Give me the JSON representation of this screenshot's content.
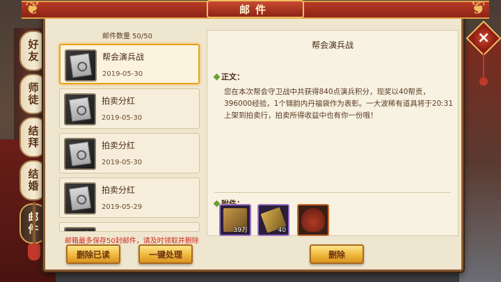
{
  "window": {
    "title": "邮件"
  },
  "close": {
    "icon": "×"
  },
  "side_tabs": [
    {
      "label": "好友",
      "active": false
    },
    {
      "label": "师徒",
      "active": false
    },
    {
      "label": "结拜",
      "active": false
    },
    {
      "label": "结婚",
      "active": false
    },
    {
      "label": "邮件",
      "active": true
    }
  ],
  "mail_list": {
    "count_label": "邮件数量 50/50",
    "items": [
      {
        "title": "帮会演兵战",
        "date": "2019-05-30",
        "icon": "mail-scroll-icon",
        "selected": true
      },
      {
        "title": "拍卖分红",
        "date": "2019-05-30",
        "icon": "mail-scroll-icon",
        "selected": false
      },
      {
        "title": "拍卖分红",
        "date": "2019-05-30",
        "icon": "mail-scroll-icon",
        "selected": false
      },
      {
        "title": "拍卖分红",
        "date": "2019-05-29",
        "icon": "mail-scroll-icon",
        "selected": false
      }
    ],
    "warning": "邮箱最多保存50封邮件，请及时领取并删除"
  },
  "buttons": {
    "delete_read": "删除已读",
    "one_click": "一键处理",
    "delete": "删除"
  },
  "detail": {
    "title": "帮会演兵战",
    "body_label": "正文：",
    "body_text": "您在本次帮会守卫战中共获得840点演兵积分，现奖以40帮贡，396000经验，1个锦韵内丹福袋作为表彰。一大波稀有道具将于20:31上架到拍卖行，拍卖所得收益中也有你一份哦！",
    "attachments_label": "附件：",
    "attachments": [
      {
        "icon": "book-icon",
        "count": "39万",
        "rarity_color": "#9a70c8"
      },
      {
        "icon": "token-icon",
        "count": "40",
        "rarity_color": "#9a70c8"
      },
      {
        "icon": "pouch-icon",
        "count": "",
        "rarity_color": "#c86a30"
      }
    ]
  },
  "colors": {
    "accent_gold": "#f0b83c",
    "title_red": "#b73a26",
    "warning_red": "#d0281c",
    "selected_border": "#e8a020"
  }
}
